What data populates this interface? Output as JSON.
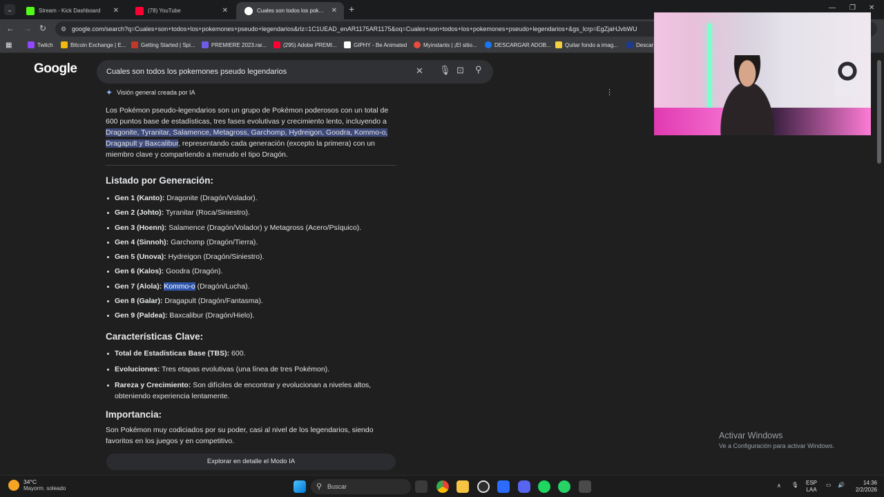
{
  "tabs": [
    {
      "title": "Stream - Kick Dashboard",
      "icon": "kick-icon",
      "color": "#53fc18"
    },
    {
      "title": "(78) YouTube",
      "icon": "youtube-icon",
      "color": "#ff0033"
    },
    {
      "title": "Cuales son todos los pokemone",
      "icon": "google-icon",
      "color": "#4285f4"
    }
  ],
  "address_bar": {
    "url": "google.com/search?q=Cuales+son+todos+los+pokemones+pseudo+legendarios&rlz=1C1UEAD_enAR1175AR1175&oq=Cuales+son+todos+los+pokemones+pseudo+legendarios+&gs_lcrp=EgZjaHJvbWU"
  },
  "bookmarks": [
    {
      "label": "Twitch",
      "color": "#9146ff"
    },
    {
      "label": "Bitcoin Exchange | E...",
      "color": "#f0b90b"
    },
    {
      "label": "Getting Started | Spi...",
      "color": "#c0392b"
    },
    {
      "label": "PREMIERE 2023.rar...",
      "color": "#6c5ce7"
    },
    {
      "label": "(295) Adobe PREMI...",
      "color": "#ff0033"
    },
    {
      "label": "GIPHY - Be Animated",
      "color": "#ffffff"
    },
    {
      "label": "Myinstants | ¡El sitio...",
      "color": "#e74c3c"
    },
    {
      "label": "DESCARGAR ADOB...",
      "color": "#1877f2"
    },
    {
      "label": "Quitar fondo a imag...",
      "color": "#f4d03f"
    },
    {
      "label": "Descar",
      "color": "#1e3a8a"
    }
  ],
  "search": {
    "query": "Cuales son todos los pokemones pseudo legendarios"
  },
  "ai_overview": {
    "label": "Visión general creada por IA",
    "intro_1": "Los Pokémon pseudo-legendarios son un grupo de Pokémon poderosos con un total de 600 puntos base de estadísticas, tres fases evolutivas y crecimiento lento, incluyendo a ",
    "intro_hl": "Dragonite, Tyranitar, Salamence, Metagross, Garchomp, Hydreigon, Goodra, Kommo-o, Dragapult y Baxcalibur",
    "intro_2": ", representando cada generación (excepto la primera) con un miembro clave y compartiendo a menudo el tipo Dragón.",
    "listado_title": "Listado por Generación:",
    "generations": [
      {
        "gen": "Gen 1 (Kanto):",
        "text": " Dragonite (Dragón/Volador)."
      },
      {
        "gen": "Gen 2 (Johto):",
        "text": " Tyranitar (Roca/Siniestro)."
      },
      {
        "gen": "Gen 3 (Hoenn):",
        "text": " Salamence (Dragón/Volador) y Metagross (Acero/Psíquico)."
      },
      {
        "gen": "Gen 4 (Sinnoh):",
        "text": " Garchomp (Dragón/Tierra)."
      },
      {
        "gen": "Gen 5 (Unova):",
        "text": " Hydreigon (Dragón/Siniestro)."
      },
      {
        "gen": "Gen 6 (Kalos):",
        "text": " Goodra (Dragón)."
      },
      {
        "gen": "Gen 7 (Alola):",
        "sel": "Kommo-o",
        "text": " (Dragón/Lucha)."
      },
      {
        "gen": "Gen 8 (Galar):",
        "text": " Dragapult (Dragón/Fantasma)."
      },
      {
        "gen": "Gen 9 (Paldea):",
        "text": " Baxcalibur (Dragón/Hielo)."
      }
    ],
    "caracteristicas_title": "Características Clave:",
    "caracteristicas": [
      {
        "key": "Total de Estadísticas Base (TBS):",
        "text": " 600."
      },
      {
        "key": "Evoluciones:",
        "text": " Tres etapas evolutivas (una línea de tres Pokémon)."
      },
      {
        "key": "Rareza y Crecimiento:",
        "text": " Son difíciles de encontrar y evolucionan a niveles altos, obteniendo experiencia lentamente."
      }
    ],
    "importancia_title": "Importancia:",
    "importancia_text": "Son Pokémon muy codiciados por su poder, casi al nivel de los legendarios, siendo favoritos en los juegos y en competitivo.",
    "explore_button": "Explorar en detalle el Modo IA"
  },
  "activation": {
    "title": "Activar Windows",
    "subtitle": "Ve a Configuración para activar Windows."
  },
  "taskbar": {
    "weather_temp": "34°C",
    "weather_desc": "Mayorm. soleado",
    "search_label": "Buscar",
    "lang_1": "ESP",
    "lang_2": "LAA",
    "time": "14:36",
    "date": "2/2/2026",
    "whatsapp_badge": "30"
  }
}
